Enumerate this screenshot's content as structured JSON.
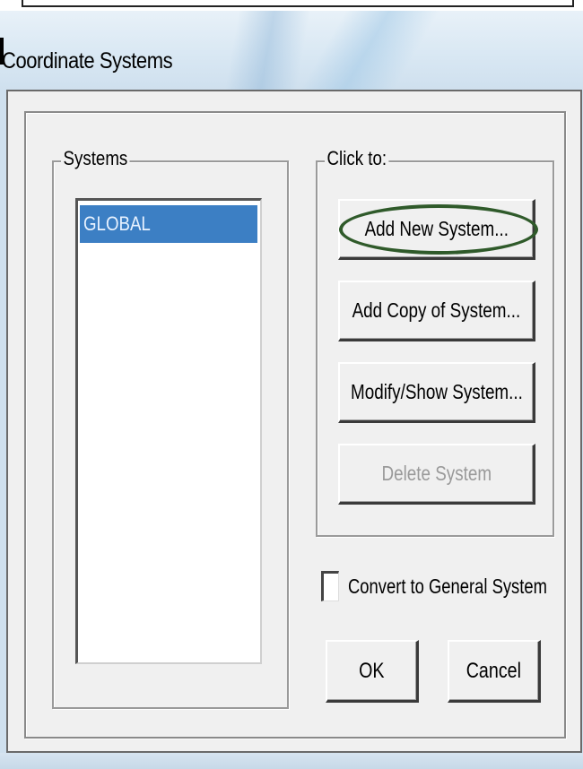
{
  "window": {
    "title": "Coordinate Systems"
  },
  "systems_group": {
    "label": "Systems",
    "items": [
      {
        "label": "GLOBAL",
        "selected": true
      }
    ]
  },
  "click_to_group": {
    "label": "Click to:",
    "buttons": {
      "add_new": {
        "label": "Add New System...",
        "enabled": true,
        "highlighted": true
      },
      "add_copy": {
        "label": "Add Copy of System...",
        "enabled": true
      },
      "modify_show": {
        "label": "Modify/Show System...",
        "enabled": true
      },
      "delete": {
        "label": "Delete System",
        "enabled": false
      }
    }
  },
  "options": {
    "convert_to_general": {
      "label": "Convert to General System",
      "checked": false
    }
  },
  "footer": {
    "ok_label": "OK",
    "cancel_label": "Cancel"
  },
  "colors": {
    "selection": "#3c7fc4",
    "highlight_ellipse": "#2f5a2a",
    "dialog_bg": "#f0f0f0",
    "disabled_text": "#9a9a9a"
  }
}
